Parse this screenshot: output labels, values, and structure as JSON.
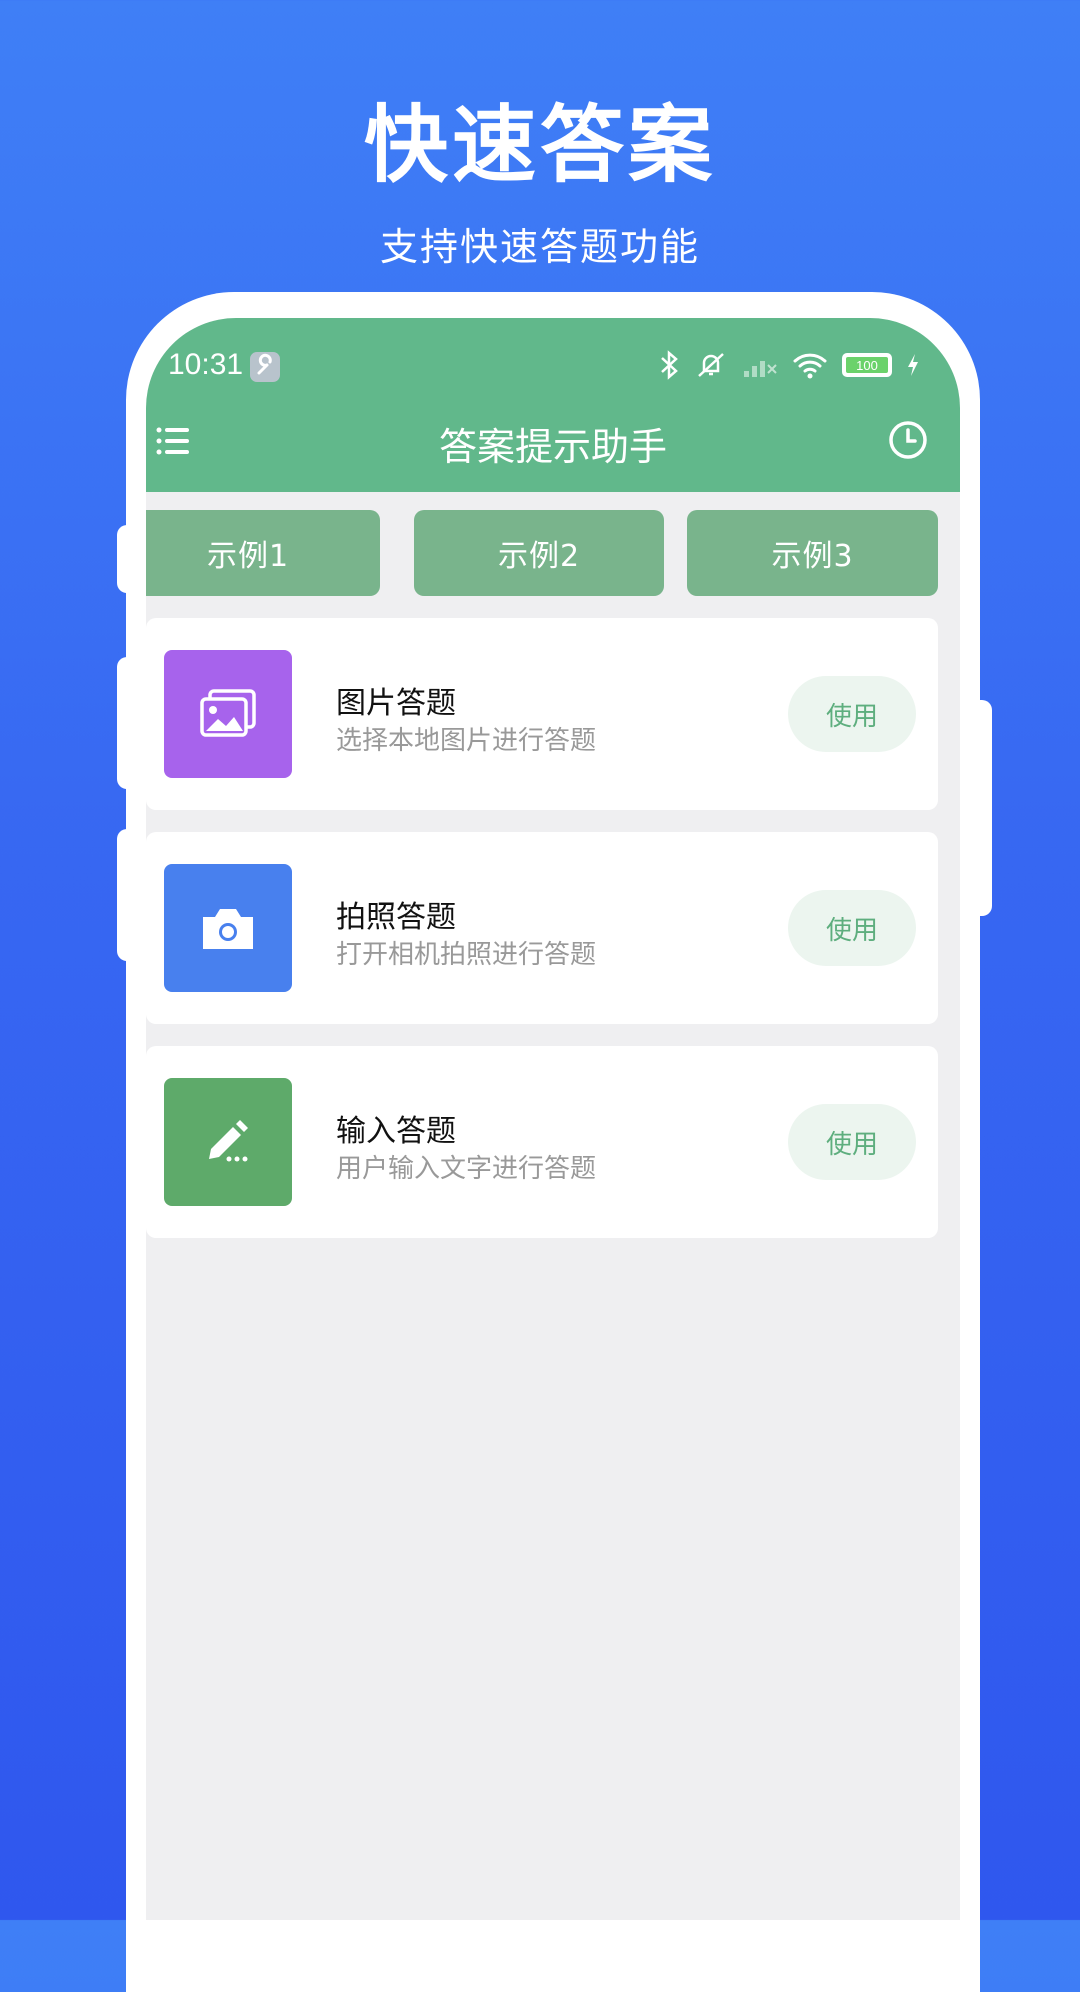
{
  "promo": {
    "title": "快速答案",
    "subtitle": "支持快速答题功能"
  },
  "status_bar": {
    "time": "10:31",
    "battery": "100",
    "icons": [
      "wrench-icon",
      "bluetooth-icon",
      "mute-icon",
      "signal-icon",
      "wifi-icon",
      "battery-icon",
      "charging-icon"
    ]
  },
  "app_bar": {
    "title": "答案提示助手",
    "left_icon": "menu-icon",
    "right_icon": "history-icon"
  },
  "tabs": [
    {
      "label": "示例1"
    },
    {
      "label": "示例2"
    },
    {
      "label": "示例3"
    }
  ],
  "cards": [
    {
      "title": "图片答题",
      "desc": "选择本地图片进行答题",
      "button": "使用",
      "icon": "image-icon",
      "color": "#A763EC"
    },
    {
      "title": "拍照答题",
      "desc": "打开相机拍照进行答题",
      "button": "使用",
      "icon": "camera-icon",
      "color": "#4880EE"
    },
    {
      "title": "输入答题",
      "desc": "用户输入文字进行答题",
      "button": "使用",
      "icon": "pencil-icon",
      "color": "#5EAA6A"
    }
  ],
  "colors": {
    "header_green": "#61B88B",
    "tab_green": "#79B48C",
    "background_blue": "#3767F2"
  }
}
